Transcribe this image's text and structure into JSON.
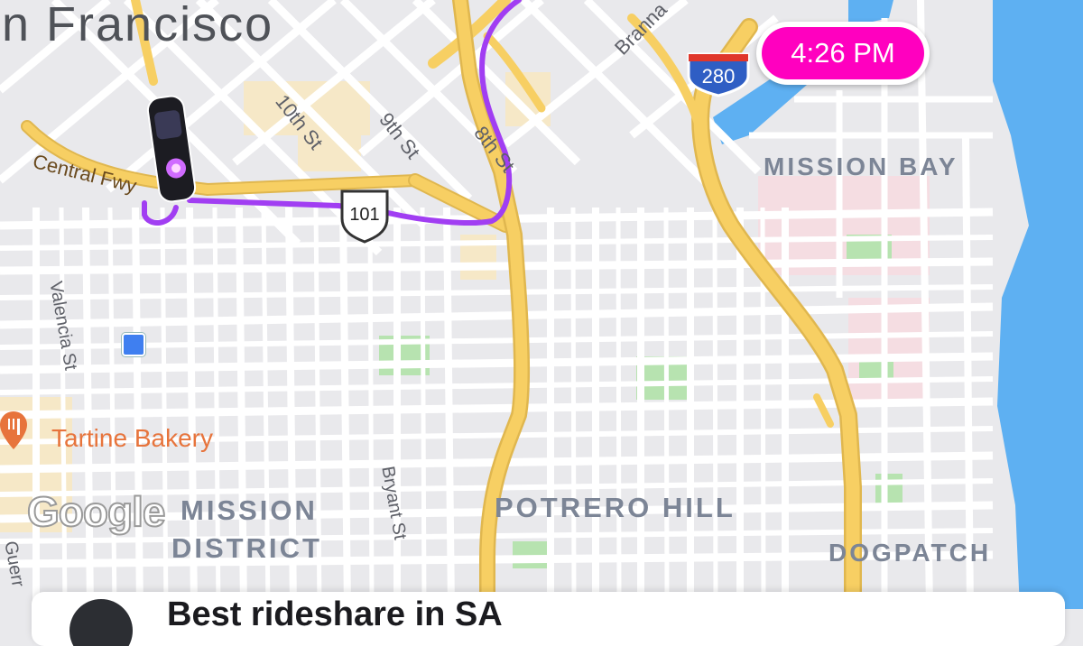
{
  "map": {
    "city_label": "n Francisco",
    "neighborhoods": [
      "MISSION BAY",
      "MISSION",
      "DISTRICT",
      "POTRERO HILL",
      "DOGPATCH"
    ],
    "streets": [
      "10th St",
      "9th St",
      "8th St",
      "Central Fwy",
      "Valencia St",
      "Bryant St",
      "Branna",
      "Guerr"
    ],
    "poi": {
      "name": "Tartine Bakery",
      "icon": "restaurant-pin-icon"
    },
    "shields": {
      "us": "101",
      "interstate": "280"
    },
    "attribution": "Google",
    "colors": {
      "route": "#a13ef2",
      "highway": "#f7cf63",
      "water": "#5eb0f2",
      "park": "#b7e3b0",
      "accent": "#ff00bf",
      "poi": "#e7743c"
    }
  },
  "eta": {
    "time": "4:26 PM"
  },
  "sheet": {
    "title": "Best rideshare in SA"
  }
}
